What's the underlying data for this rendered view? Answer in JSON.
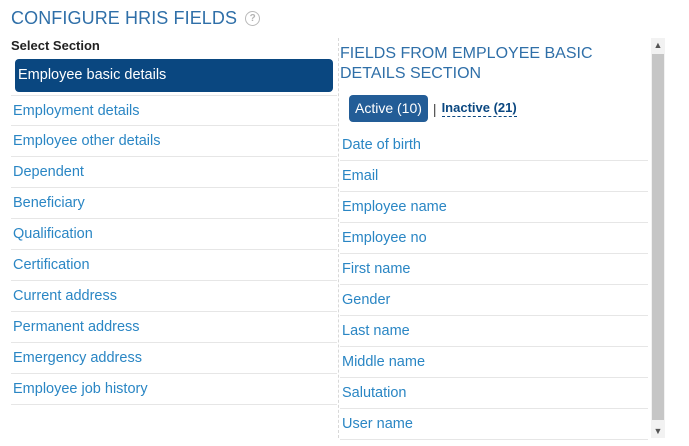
{
  "header": {
    "title": "CONFIGURE HRIS FIELDS",
    "help_icon": "?"
  },
  "left": {
    "section_label": "Select Section",
    "selected_section": "Employee basic details",
    "sections": [
      "Employment details",
      "Employee other details",
      "Dependent",
      "Beneficiary",
      "Qualification",
      "Certification",
      "Current address",
      "Permanent address",
      "Emergency address",
      "Employee job history"
    ]
  },
  "right": {
    "title": "FIELDS FROM EMPLOYEE BASIC DETAILS SECTION",
    "tabs": {
      "active": "Active (10)",
      "separator": "|",
      "inactive": "Inactive (21)"
    },
    "fields": [
      "Date of birth",
      "Email",
      "Employee name",
      "Employee no",
      "First name",
      "Gender",
      "Last name",
      "Middle name",
      "Salutation",
      "User name"
    ]
  },
  "scrollbar": {
    "up_arrow": "▲",
    "down_arrow": "▼"
  }
}
